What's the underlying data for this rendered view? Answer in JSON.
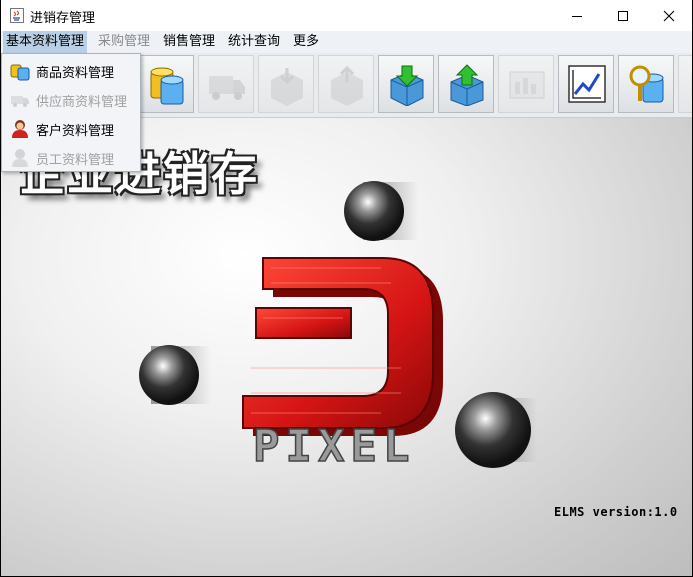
{
  "window": {
    "title": "进销存管理"
  },
  "menubar": {
    "items": [
      {
        "label": "基本资料管理",
        "state": "open"
      },
      {
        "label": "采购管理",
        "state": "disabled"
      },
      {
        "label": "销售管理",
        "state": "enabled"
      },
      {
        "label": "统计查询",
        "state": "enabled"
      },
      {
        "label": "更多",
        "state": "enabled"
      }
    ]
  },
  "dropdown": {
    "items": [
      {
        "label": "商品资料管理",
        "enabled": true,
        "icon": "goods-db-icon"
      },
      {
        "label": "供应商资料管理",
        "enabled": false,
        "icon": "supplier-truck-icon"
      },
      {
        "label": "客户资料管理",
        "enabled": true,
        "icon": "customer-person-icon"
      },
      {
        "label": "员工资料管理",
        "enabled": false,
        "icon": "employee-person-icon"
      }
    ]
  },
  "toolbar": {
    "buttons": [
      {
        "icon": "database-cylinder-icon",
        "enabled": true
      },
      {
        "icon": "truck-icon",
        "enabled": false
      },
      {
        "icon": "box-in-icon",
        "enabled": false
      },
      {
        "icon": "box-out-icon",
        "enabled": false
      },
      {
        "icon": "stock-in-arrow-icon",
        "enabled": true
      },
      {
        "icon": "stock-out-arrow-icon",
        "enabled": true
      },
      {
        "icon": "report-bars-icon",
        "enabled": false
      },
      {
        "icon": "line-chart-icon",
        "enabled": true
      },
      {
        "icon": "search-magnifier-icon",
        "enabled": true
      },
      {
        "icon": "more-icon",
        "enabled": false
      }
    ]
  },
  "splash": {
    "title": "企业进销存",
    "logo_text": "PIXEL",
    "version": "ELMS  version:1.0"
  },
  "colors": {
    "logo_red": "#d41414",
    "menu_active": "#b8cfe5",
    "menubar_bg": "#eef1f6"
  }
}
